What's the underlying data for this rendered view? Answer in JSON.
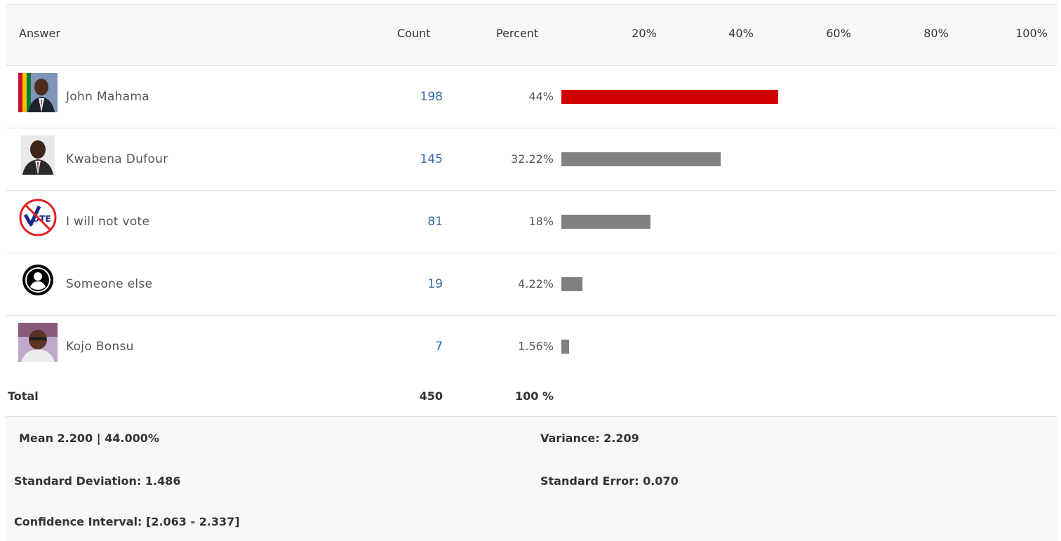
{
  "header": {
    "answer": "Answer",
    "count": "Count",
    "percent": "Percent",
    "ticks": [
      "20%",
      "40%",
      "60%",
      "80%",
      "100%"
    ]
  },
  "rows": [
    {
      "name": "John Mahama",
      "count": "198",
      "percent": "44%",
      "icon": "john-mahama-photo"
    },
    {
      "name": "Kwabena Dufour",
      "count": "145",
      "percent": "32.22%",
      "icon": "kwabena-dufour-photo"
    },
    {
      "name": "I will not vote",
      "count": "81",
      "percent": "18%",
      "icon": "no-vote-icon"
    },
    {
      "name": "Someone else",
      "count": "19",
      "percent": "4.22%",
      "icon": "person-icon"
    },
    {
      "name": "Kojo Bonsu",
      "count": "7",
      "percent": "1.56%",
      "icon": "kojo-bonsu-photo"
    }
  ],
  "total": {
    "label": "Total",
    "count": "450",
    "percent": "100 %"
  },
  "stats": {
    "mean": "Mean 2.200 | 44.000%",
    "variance": "Variance: 2.209",
    "std_dev": "Standard Deviation: 1.486",
    "std_err": "Standard Error: 0.070",
    "ci": "Confidence Interval: [2.063 - 2.337]"
  },
  "colors": {
    "top_bar": "#d10000",
    "bar": "#808080",
    "count_link": "#2d6ca8"
  },
  "chart_data": {
    "type": "bar",
    "orientation": "horizontal",
    "categories": [
      "John Mahama",
      "Kwabena Dufour",
      "I will not vote",
      "Someone else",
      "Kojo Bonsu"
    ],
    "values": [
      44,
      32.22,
      18,
      4.22,
      1.56
    ],
    "counts": [
      198,
      145,
      81,
      19,
      7
    ],
    "xlim": [
      0,
      100
    ],
    "x_ticks": [
      "20%",
      "40%",
      "60%",
      "80%",
      "100%"
    ],
    "grid": false
  }
}
